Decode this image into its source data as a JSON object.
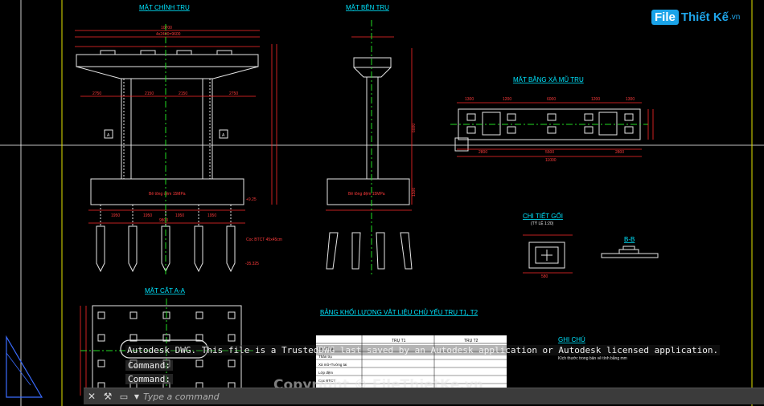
{
  "drawing": {
    "titles": {
      "front_elevation": "MẶT CHÍNH TRỤ",
      "side_elevation": "MẶT BÊN TRỤ",
      "cap_plan": "MẶT BẰNG XÀ MŨ TRỤ",
      "bearing_detail": "CHI TIẾT GỐI",
      "section_bb": "B-B",
      "section_aa": "MẶT CẮT A-A",
      "quantity_table": "BẢNG KHỐI LƯỢNG VẬT LIỆU CHỦ YẾU TRỤ T1, T2",
      "notes": "GHI CHÚ"
    },
    "labels": {
      "section_a": "A",
      "lean_concrete": "Bê tông đệm 15MPa",
      "pile_note": "Cọc BTCT 45x45cm",
      "bearing_scale": "(TỶ LỆ 1:20)",
      "notes_line": "Kích thước trong bản vẽ tính bằng mm"
    },
    "dims": {
      "top_total": "10700",
      "top_sub": "4x2400=9600",
      "cap_left": "2750",
      "cap_mid": "2150",
      "cap_right": "2750",
      "pile_spacing": "1950",
      "footing_total": "9800",
      "plan_a": "1300",
      "plan_b": "1200",
      "plan_c": "6000",
      "plan_bottom": "11000",
      "plan_mid": "5500",
      "plan_l": "2800",
      "bearing_w": "580",
      "elev_top": "+9.25",
      "elev_bot": "-35.325",
      "side_height": "6000",
      "side_footing": "1500"
    },
    "table": {
      "col_t1": "TRỤ T1",
      "col_t2": "TRỤ T2",
      "rows": [
        "Bệ móng",
        "Thân trụ",
        "Xà mũ+Tường tai",
        "Lớp đệm",
        "Cọc BTCT"
      ]
    }
  },
  "autocad": {
    "notice": "Autodesk DWG.  This file is a TrustedDWG last saved by an Autodesk application or Autodesk licensed application.",
    "history": [
      "Command:",
      "Command:"
    ],
    "placeholder": "Type a command"
  },
  "watermark": {
    "copyright": "Copyright © FileThietKe.vn",
    "logo_a": "File",
    "logo_b": "Thiết Kế",
    "logo_c": ".vn"
  },
  "colors": {
    "background": "#000000",
    "title": "#00e5ff",
    "dimension": "#ff2a2a",
    "centerline": "#22dd22",
    "command_bar": "#3b3b3b"
  },
  "icons": [
    "close-icon",
    "wrench-icon",
    "command-line-icon",
    "chevron-down-icon"
  ]
}
